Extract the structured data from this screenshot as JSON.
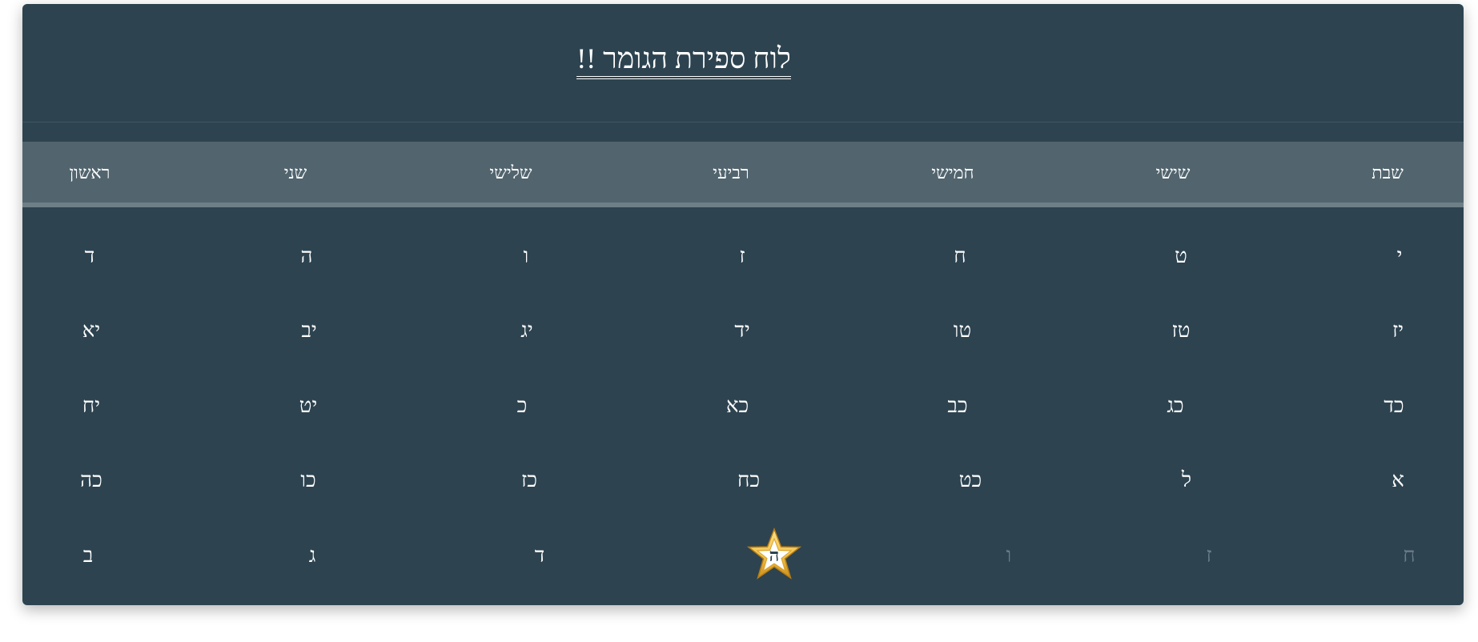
{
  "title": "לוח ספירת הגומר !!",
  "days": [
    "ראשון",
    "שני",
    "שלישי",
    "רביעי",
    "חמישי",
    "שישי",
    "שבת"
  ],
  "weeks": [
    [
      "ד",
      "ה",
      "ו",
      "ז",
      "ח",
      "ט",
      "י"
    ],
    [
      "יא",
      "יב",
      "יג",
      "יד",
      "טו",
      "טז",
      "יז"
    ],
    [
      "יח",
      "יט",
      "כ",
      "כא",
      "כב",
      "כג",
      "כד"
    ],
    [
      "כה",
      "כו",
      "כז",
      "כח",
      "כט",
      "ל",
      "א"
    ],
    [
      "ב",
      "ג",
      "ד",
      "ה",
      "ו",
      "ז",
      "ח"
    ]
  ],
  "today": {
    "week": 4,
    "day": 3,
    "label": "ה"
  },
  "dimmed_from": {
    "week": 4,
    "day": 4
  },
  "colors": {
    "background": "#2d4350",
    "header_row": "#52656f",
    "text": "#ffffff",
    "dim_text": "#6b7e88",
    "star": "#f2c24a"
  },
  "icons": {
    "today_marker": "star-icon"
  }
}
